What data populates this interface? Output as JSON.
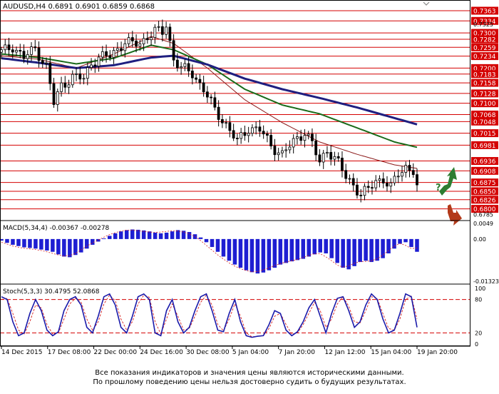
{
  "chart_data": {
    "type": "candlestick",
    "symbol_line": "AUDUSD,H4  0.6891 0.6901 0.6859 0.6868",
    "price_axis": {
      "ylim": [
        0.6785,
        0.7363
      ],
      "labels": [
        "0.7363",
        "0.7334",
        "0.7325",
        "0.7300",
        "0.7282",
        "0.7259",
        "0.7234",
        "0.7200",
        "0.7183",
        "0.7158",
        "0.7128",
        "0.7100",
        "0.7068",
        "0.7048",
        "0.7015",
        "0.6981",
        "0.6936",
        "0.6908",
        "0.6875",
        "0.6850",
        "0.6826",
        "0.6800",
        "0.6785"
      ],
      "levels": [
        0.7363,
        0.7334,
        0.73,
        0.7282,
        0.7259,
        0.7234,
        0.72,
        0.7183,
        0.7158,
        0.7128,
        0.71,
        0.7068,
        0.7048,
        0.7015,
        0.6981,
        0.6936,
        0.6908,
        0.6875,
        0.685,
        0.6826,
        0.68
      ],
      "small_labels": [
        "0.7325",
        "0.6785"
      ],
      "current_price": "0.6868"
    },
    "price_path": [
      [
        0,
        0.7245
      ],
      [
        3,
        0.7262
      ],
      [
        6,
        0.723
      ],
      [
        9,
        0.7255
      ],
      [
        12,
        0.7205
      ],
      [
        14,
        0.71
      ],
      [
        16,
        0.715
      ],
      [
        19,
        0.7175
      ],
      [
        22,
        0.717
      ],
      [
        24,
        0.7215
      ],
      [
        26,
        0.723
      ],
      [
        29,
        0.7235
      ],
      [
        31,
        0.7255
      ],
      [
        33,
        0.7275
      ],
      [
        35,
        0.7268
      ],
      [
        37,
        0.727
      ],
      [
        39,
        0.729
      ],
      [
        41,
        0.7305
      ],
      [
        43,
        0.73
      ],
      [
        44,
        0.7325
      ],
      [
        46,
        0.7225
      ],
      [
        48,
        0.72
      ],
      [
        51,
        0.7185
      ],
      [
        54,
        0.714
      ],
      [
        57,
        0.708
      ],
      [
        60,
        0.704
      ],
      [
        63,
        0.699
      ],
      [
        66,
        0.703
      ],
      [
        69,
        0.7025
      ],
      [
        72,
        0.698
      ],
      [
        75,
        0.6955
      ],
      [
        78,
        0.699
      ],
      [
        81,
        0.702
      ],
      [
        83,
        0.6985
      ],
      [
        85,
        0.693
      ],
      [
        87,
        0.697
      ],
      [
        90,
        0.693
      ],
      [
        92,
        0.689
      ],
      [
        94,
        0.687
      ],
      [
        96,
        0.684
      ],
      [
        98,
        0.6855
      ],
      [
        100,
        0.688
      ],
      [
        102,
        0.6885
      ],
      [
        104,
        0.686
      ],
      [
        106,
        0.69
      ],
      [
        108,
        0.692
      ],
      [
        110,
        0.6908
      ],
      [
        111,
        0.6868
      ]
    ],
    "ma": [
      {
        "color": "#8b1a1a",
        "points": [
          [
            0,
            0.7235
          ],
          [
            10,
            0.7225
          ],
          [
            20,
            0.72
          ],
          [
            30,
            0.724
          ],
          [
            40,
            0.729
          ],
          [
            46,
            0.727
          ],
          [
            55,
            0.72
          ],
          [
            65,
            0.711
          ],
          [
            75,
            0.7045
          ],
          [
            85,
            0.699
          ],
          [
            95,
            0.6955
          ],
          [
            105,
            0.6925
          ],
          [
            111,
            0.6915
          ]
        ]
      },
      {
        "color": "#1a6b1a",
        "points": [
          [
            0,
            0.724
          ],
          [
            10,
            0.723
          ],
          [
            20,
            0.7212
          ],
          [
            30,
            0.7228
          ],
          [
            40,
            0.7265
          ],
          [
            46,
            0.7252
          ],
          [
            55,
            0.721
          ],
          [
            65,
            0.714
          ],
          [
            75,
            0.7095
          ],
          [
            85,
            0.707
          ],
          [
            95,
            0.703
          ],
          [
            105,
            0.699
          ],
          [
            111,
            0.6975
          ]
        ]
      },
      {
        "color": "#1f1f80",
        "points": [
          [
            0,
            0.7228
          ],
          [
            10,
            0.7215
          ],
          [
            20,
            0.72
          ],
          [
            30,
            0.7208
          ],
          [
            40,
            0.723
          ],
          [
            46,
            0.7235
          ],
          [
            55,
            0.721
          ],
          [
            65,
            0.717
          ],
          [
            75,
            0.714
          ],
          [
            85,
            0.7115
          ],
          [
            95,
            0.7088
          ],
          [
            105,
            0.7058
          ],
          [
            111,
            0.704
          ]
        ]
      }
    ],
    "macd": {
      "label": "MACD(5,34,4) -0.00367 -0.00278",
      "axis_labels": [
        "0.0049",
        "0.00",
        "-0.01323"
      ],
      "ylim": [
        -0.01323,
        0.0049
      ],
      "histogram": [
        -0.0005,
        -0.0012,
        -0.0018,
        -0.0022,
        -0.0026,
        -0.0028,
        -0.003,
        -0.0033,
        -0.0036,
        -0.004,
        -0.0048,
        -0.0055,
        -0.0057,
        -0.005,
        -0.0042,
        -0.003,
        -0.0018,
        -0.0008,
        0.0002,
        0.001,
        0.0018,
        0.0024,
        0.0028,
        0.003,
        0.0029,
        0.0027,
        0.0024,
        0.002,
        0.0018,
        0.002,
        0.0024,
        0.0028,
        0.0026,
        0.0022,
        0.0015,
        0.0005,
        -0.001,
        -0.0025,
        -0.004,
        -0.0055,
        -0.0068,
        -0.008,
        -0.009,
        -0.0098,
        -0.0104,
        -0.0108,
        -0.0105,
        -0.0098,
        -0.009,
        -0.008,
        -0.0075,
        -0.007,
        -0.0066,
        -0.0062,
        -0.0055,
        -0.0048,
        -0.0042,
        -0.0045,
        -0.006,
        -0.0075,
        -0.009,
        -0.0095,
        -0.0085,
        -0.0072,
        -0.0068,
        -0.0072,
        -0.0068,
        -0.006,
        -0.0045,
        -0.003,
        -0.0015,
        -0.001,
        -0.0025,
        -0.004
      ],
      "signal": [
        -0.001,
        -0.0016,
        -0.0022,
        -0.0026,
        -0.0029,
        -0.0031,
        -0.0033,
        -0.0036,
        -0.004,
        -0.0045,
        -0.005,
        -0.0053,
        -0.0052,
        -0.0045,
        -0.0034,
        -0.0022,
        -0.0012,
        -0.0003,
        0.0006,
        0.0014,
        0.002,
        0.0025,
        0.0028,
        0.0028,
        0.0026,
        0.0024,
        0.0022,
        0.0021,
        0.0022,
        0.0024,
        0.0026,
        0.0025,
        0.0022,
        0.0016,
        0.0008,
        -0.0005,
        -0.002,
        -0.0035,
        -0.005,
        -0.0063,
        -0.0075,
        -0.0085,
        -0.0093,
        -0.0099,
        -0.0103,
        -0.0102,
        -0.0097,
        -0.009,
        -0.0083,
        -0.0077,
        -0.0072,
        -0.0068,
        -0.0064,
        -0.0058,
        -0.0051,
        -0.0046,
        -0.0046,
        -0.0056,
        -0.0068,
        -0.0082,
        -0.0088,
        -0.0084,
        -0.0076,
        -0.0071,
        -0.007,
        -0.0068,
        -0.0062,
        -0.005,
        -0.0036,
        -0.0022,
        -0.0014,
        -0.002,
        -0.003,
        -0.0028
      ]
    },
    "stoch": {
      "label": "Stoch(5,3,3) 30.4795 52.0868",
      "axis_labels": [
        "100",
        "80",
        "20",
        "0"
      ],
      "ylim": [
        0,
        100
      ],
      "levels": [
        80,
        20
      ],
      "main": [
        85,
        80,
        40,
        15,
        20,
        55,
        80,
        60,
        25,
        15,
        22,
        60,
        80,
        85,
        70,
        30,
        20,
        50,
        85,
        90,
        70,
        30,
        20,
        50,
        85,
        90,
        80,
        20,
        15,
        60,
        80,
        40,
        20,
        30,
        60,
        85,
        90,
        60,
        25,
        22,
        55,
        80,
        40,
        15,
        12,
        14,
        15,
        35,
        60,
        55,
        25,
        15,
        22,
        40,
        65,
        80,
        50,
        20,
        55,
        82,
        85,
        60,
        30,
        40,
        70,
        90,
        80,
        45,
        20,
        25,
        55,
        90,
        85,
        30
      ],
      "signal": [
        80,
        82,
        55,
        25,
        18,
        40,
        70,
        65,
        35,
        18,
        20,
        45,
        72,
        82,
        75,
        45,
        25,
        40,
        72,
        88,
        78,
        45,
        25,
        40,
        72,
        88,
        84,
        40,
        18,
        45,
        72,
        50,
        25,
        28,
        50,
        75,
        88,
        70,
        35,
        24,
        45,
        72,
        50,
        20,
        13,
        14,
        15,
        28,
        50,
        55,
        35,
        18,
        20,
        35,
        55,
        75,
        60,
        30,
        45,
        72,
        85,
        68,
        40,
        38,
        60,
        85,
        82,
        55,
        28,
        25,
        45,
        80,
        86,
        45
      ]
    },
    "time_labels": [
      "14 Dec 2015",
      "17 Dec 08:00",
      "22 Dec 00:00",
      "24 Dec 16:00",
      "30 Dec 08:00",
      "5 Jan 04:00",
      "7 Jan 20:00",
      "12 Jan 12:00",
      "15 Jan 04:00",
      "19 Jan 20:00"
    ],
    "up_arrow_color": "#2e7d32",
    "down_arrow_color": "#b33a1a",
    "question_mark": "?"
  },
  "disclaimer": {
    "line1": "Все показания индикаторов и значения цены являются историческими данными.",
    "line2": "По прошлому поведению цены нельзя достоверно судить о будущих результатах."
  }
}
